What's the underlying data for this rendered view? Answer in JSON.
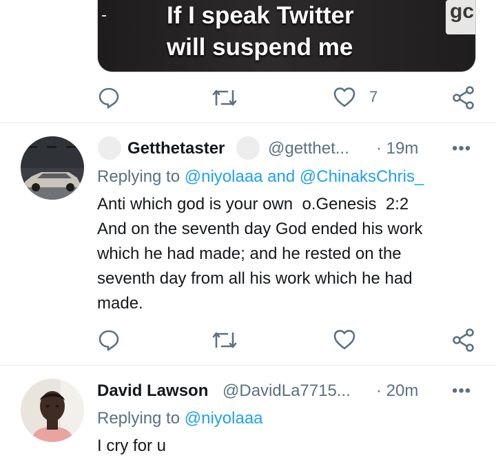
{
  "top_tweet": {
    "caption_line1": "If I speak Twitter",
    "caption_line2": "will suspend me",
    "caption_corner": "gc",
    "like_count": "7"
  },
  "tweet1": {
    "name": "Getthetaster",
    "handle": "@getthet...",
    "time": "· 19m",
    "more": "•••",
    "replying_label": "Replying to ",
    "replying_mention1": "@niyolaaa",
    "replying_and": " and ",
    "replying_mention2": "@ChinaksChris_",
    "text": "Anti which god is your own  o.Genesis  2:2\nAnd on the seventh day God ended his work\nwhich he had made; and he rested on the\nseventh day from all his work which he had\nmade."
  },
  "tweet2": {
    "name": "David Lawson",
    "handle": "@DavidLa7715...",
    "time": "· 20m",
    "more": "•••",
    "replying_label": "Replying to ",
    "replying_mention1": "@niyolaaa",
    "text": "I cry for u"
  },
  "icons": {
    "reply": "reply-icon",
    "retweet": "retweet-icon",
    "like": "heart-icon",
    "share": "share-icon",
    "more": "more-icon"
  },
  "colors": {
    "secondary_text": "#5b7083",
    "mention": "#1da1f2",
    "primary_text": "#14171a"
  }
}
